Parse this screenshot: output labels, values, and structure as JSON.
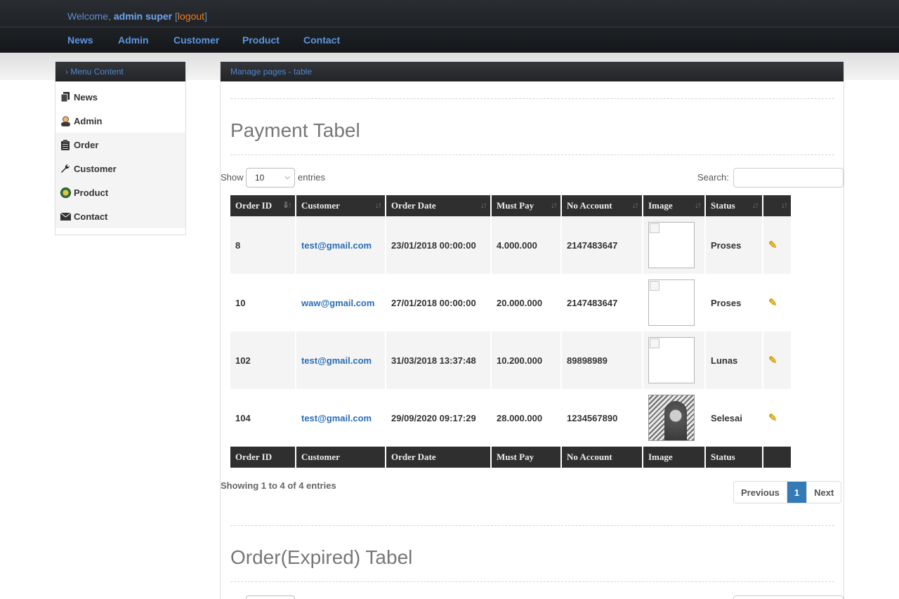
{
  "header": {
    "welcome_prefix": "Welcome,",
    "user_name": "admin super",
    "bracket_open": "[",
    "logout_label": "logout",
    "bracket_close": "]"
  },
  "nav": [
    "News",
    "Admin",
    "Customer",
    "Product",
    "Contact"
  ],
  "sidebar": {
    "title": "› Menu Content",
    "items": [
      {
        "label": "News",
        "icon": "document-icon"
      },
      {
        "label": "Admin",
        "icon": "user-icon"
      },
      {
        "label": "Order",
        "icon": "clipboard-icon"
      },
      {
        "label": "Customer",
        "icon": "wrench-icon"
      },
      {
        "label": "Product",
        "icon": "globe-icon"
      },
      {
        "label": "Contact",
        "icon": "envelope-icon"
      }
    ]
  },
  "main": {
    "breadcrumb": "Manage pages - table",
    "payment_title": "Payment Tabel",
    "show_label": "Show",
    "entries_label": "entries",
    "page_length": "10",
    "search_label": "Search:",
    "columns": [
      "Order ID",
      "Customer",
      "Order Date",
      "Must Pay",
      "No Account",
      "Image",
      "Status",
      ""
    ],
    "rows": [
      {
        "order_id": "8",
        "customer": "test@gmail.com",
        "order_date": "23/01/2018 00:00:00",
        "must_pay": "4.000.000",
        "no_account": "2147483647",
        "image": "broken",
        "status": "Proses"
      },
      {
        "order_id": "10",
        "customer": "waw@gmail.com",
        "order_date": "27/01/2018 00:00:00",
        "must_pay": "20.000.000",
        "no_account": "2147483647",
        "image": "broken",
        "status": "Proses"
      },
      {
        "order_id": "102",
        "customer": "test@gmail.com",
        "order_date": "31/03/2018 13:37:48",
        "must_pay": "10.200.000",
        "no_account": "89898989",
        "image": "broken",
        "status": "Lunas"
      },
      {
        "order_id": "104",
        "customer": "test@gmail.com",
        "order_date": "29/09/2020 09:17:29",
        "must_pay": "28.000.000",
        "no_account": "1234567890",
        "image": "photo",
        "status": "Selesai"
      }
    ],
    "info": "Showing 1 to 4 of 4 entries",
    "pager": {
      "previous": "Previous",
      "current": "1",
      "next": "Next"
    },
    "expired_title": "Order(Expired) Tabel"
  },
  "colors": {
    "nav_link": "#5b96e0",
    "logout": "#f07f1e",
    "link": "#2a6db5",
    "active_page": "#337ab7"
  }
}
